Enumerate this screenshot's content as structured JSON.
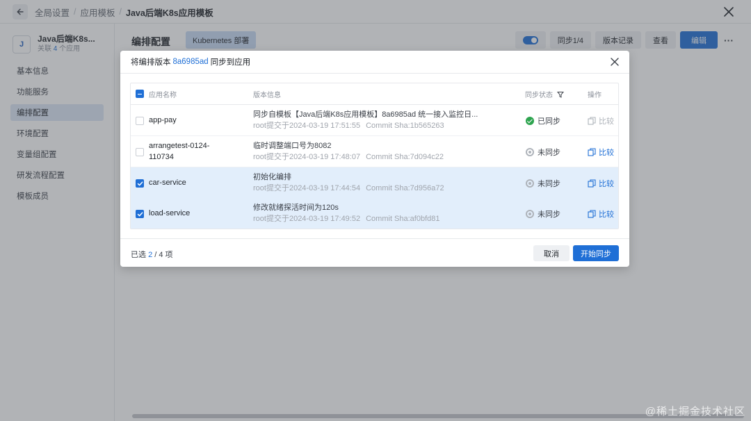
{
  "topbar": {
    "breadcrumbs": [
      "全局设置",
      "应用模板",
      "Java后端K8s应用模板"
    ]
  },
  "sidebar": {
    "avatar_letter": "J",
    "app_name": "Java后端K8s...",
    "app_sub_prefix": "关联",
    "app_sub_count": "4",
    "app_sub_suffix": "个应用",
    "items": [
      {
        "label": "基本信息"
      },
      {
        "label": "功能服务"
      },
      {
        "label": "编排配置"
      },
      {
        "label": "环境配置"
      },
      {
        "label": "变量组配置"
      },
      {
        "label": "研发流程配置"
      },
      {
        "label": "模板成员"
      }
    ]
  },
  "main": {
    "title": "编排配置",
    "tag": "Kubernetes 部署",
    "sync_label": "同步1/4",
    "history_label": "版本记录",
    "view_label": "查看",
    "edit_label": "编辑"
  },
  "dialog": {
    "title_prefix": "将编排版本",
    "version": "8a6985ad",
    "title_suffix": "同步到应用",
    "columns": {
      "app": "应用名称",
      "version": "版本信息",
      "status": "同步状态",
      "action": "操作"
    },
    "rows": [
      {
        "app": "app-pay",
        "msg": "同步自模板【Java后端K8s应用模板】8a6985ad 统一接入监控日...",
        "submitted": "root提交于2024-03-19 17:51:55",
        "commit": "Commit Sha:1b565263",
        "status": "已同步",
        "compare": "比较"
      },
      {
        "app": "arrangetest-0124-110734",
        "msg": "临时调整端口号为8082",
        "submitted": "root提交于2024-03-19 17:48:07",
        "commit": "Commit Sha:7d094c22",
        "status": "未同步",
        "compare": "比较"
      },
      {
        "app": "car-service",
        "msg": "初始化编排",
        "submitted": "root提交于2024-03-19 17:44:54",
        "commit": "Commit Sha:7d956a72",
        "status": "未同步",
        "compare": "比较"
      },
      {
        "app": "load-service",
        "msg": "修改就绪探活时间为120s",
        "submitted": "root提交于2024-03-19 17:49:52",
        "commit": "Commit Sha:af0bfd81",
        "status": "未同步",
        "compare": "比较"
      }
    ],
    "footer": {
      "selected_prefix": "已选",
      "selected": "2",
      "total_text": "/ 4 项",
      "cancel": "取消",
      "start": "开始同步"
    }
  },
  "watermark": "@稀土掘金技术社区"
}
